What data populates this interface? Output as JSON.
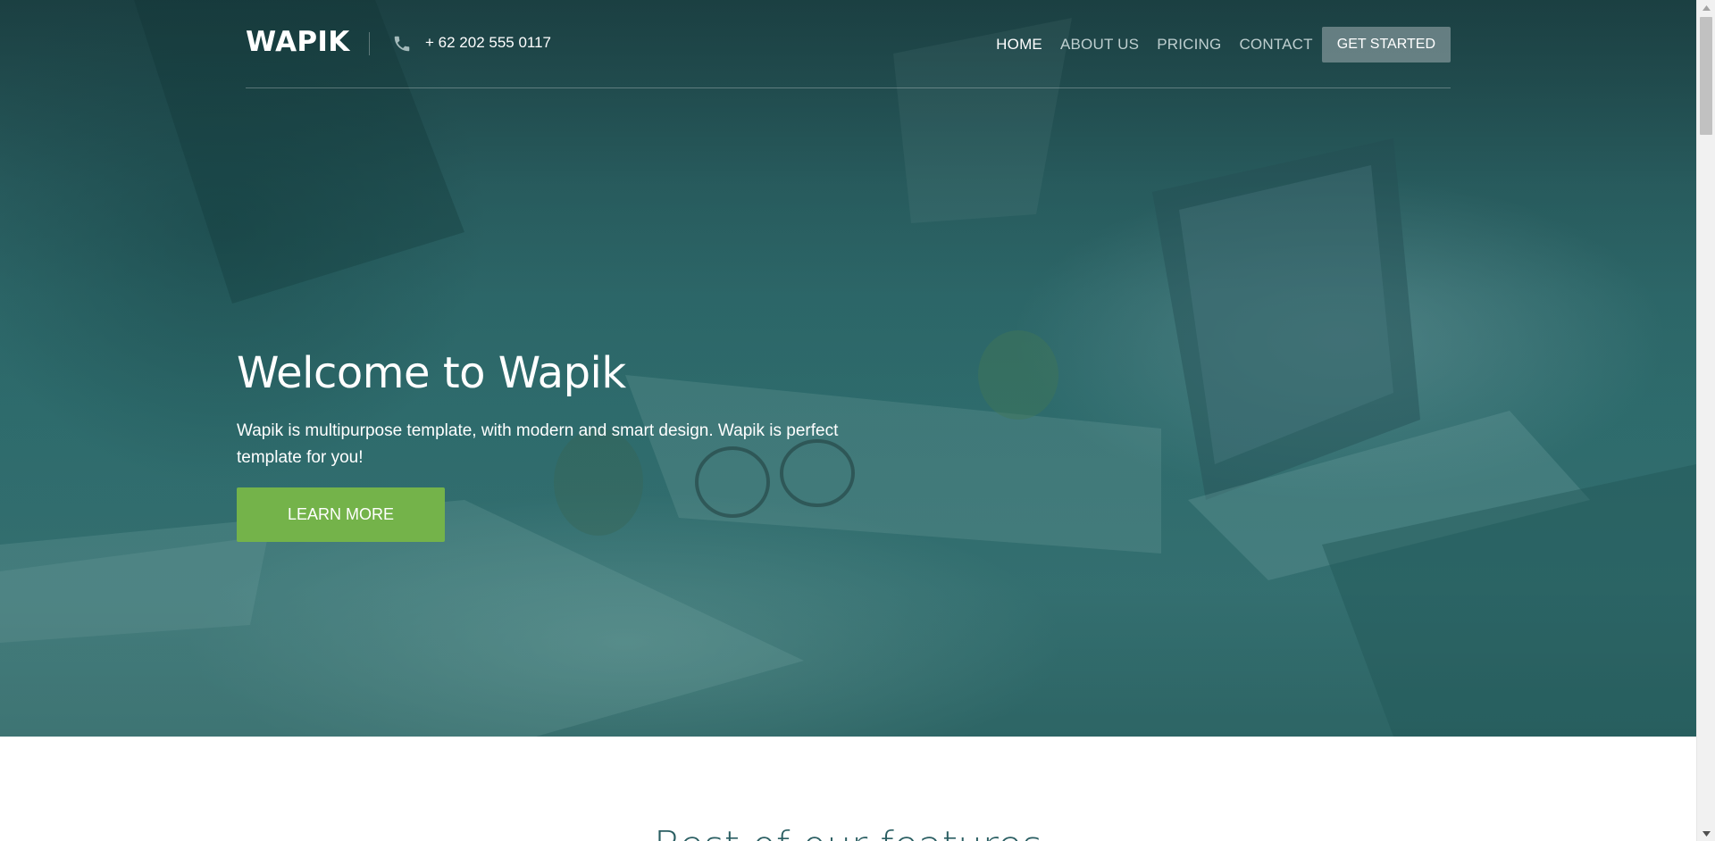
{
  "brand": {
    "logo": "WAPIK",
    "phone": "+ 62 202 555 0117"
  },
  "nav": {
    "items": [
      {
        "label": "HOME",
        "active": true
      },
      {
        "label": "ABOUT US",
        "active": false
      },
      {
        "label": "PRICING",
        "active": false
      },
      {
        "label": "CONTACT",
        "active": false
      }
    ],
    "cta_label": "GET STARTED"
  },
  "hero": {
    "title": "Welcome to Wapik",
    "subtitle": "Wapik is multipurpose template, with modern and smart design. Wapik is perfect template for you!",
    "button_label": "LEARN MORE"
  },
  "next_section": {
    "heading": "Best of our features"
  },
  "icons": {
    "phone": "phone-icon",
    "scroll_up": "chevron-up-icon",
    "scroll_down": "chevron-down-icon"
  },
  "colors": {
    "accent_green": "#74b34a",
    "hero_teal": "#2f6a6b",
    "heading_teal": "#2a5e62"
  }
}
